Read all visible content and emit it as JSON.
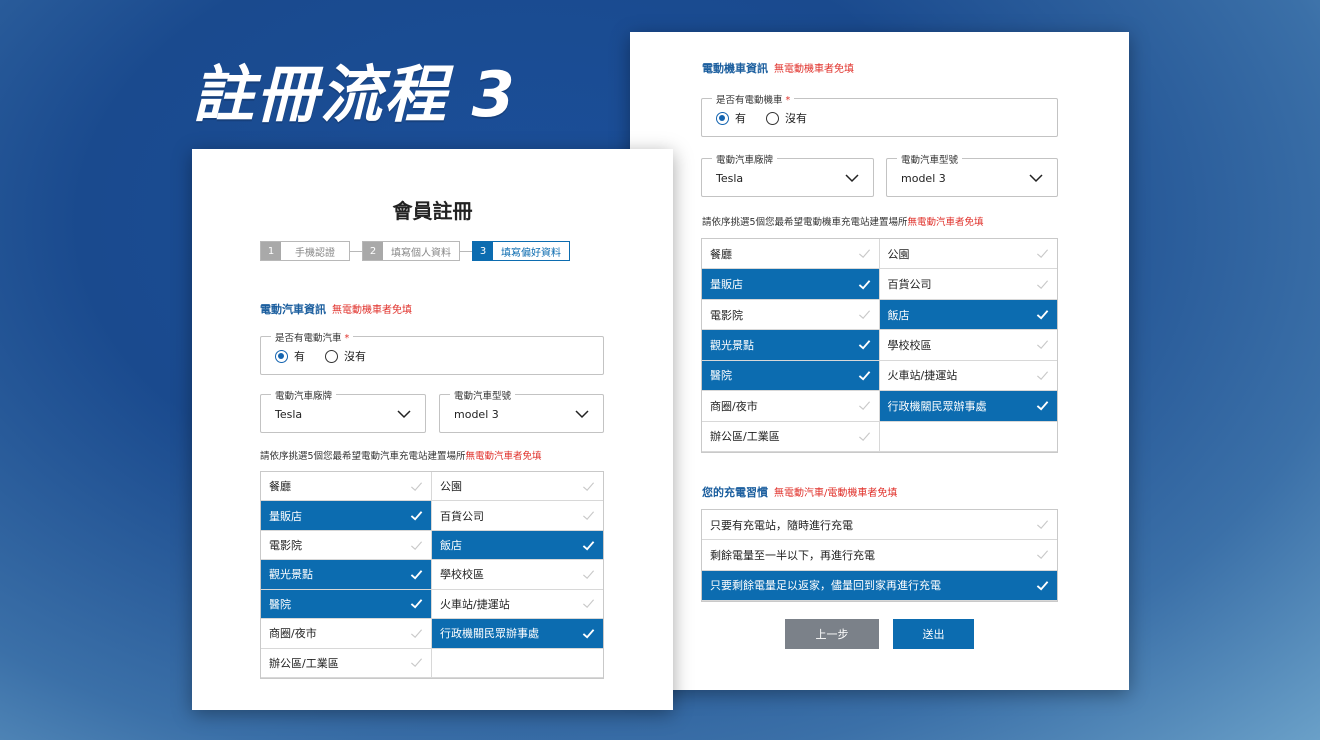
{
  "hero_title": "註冊流程 3",
  "back": {
    "moto_section": {
      "title": "電動機車資訊",
      "note": "無電動機車者免填"
    },
    "has_moto": {
      "legend": "是否有電動機車",
      "req": "*",
      "yes": "有",
      "no": "沒有"
    },
    "brand": {
      "legend": "電動汽車廠牌",
      "value": "Tesla"
    },
    "model": {
      "legend": "電動汽車型號",
      "value": "model 3"
    },
    "hint": {
      "text": "請依序挑選5個您最希望電動機車充電站建置場所",
      "note": "無電動汽車者免填"
    },
    "places": [
      {
        "label": "餐廳",
        "selected": false
      },
      {
        "label": "公園",
        "selected": false
      },
      {
        "label": "量販店",
        "selected": true
      },
      {
        "label": "百貨公司",
        "selected": false
      },
      {
        "label": "電影院",
        "selected": false
      },
      {
        "label": "飯店",
        "selected": true
      },
      {
        "label": "觀光景點",
        "selected": true
      },
      {
        "label": "學校校區",
        "selected": false
      },
      {
        "label": "醫院",
        "selected": true
      },
      {
        "label": "火車站/捷運站",
        "selected": false
      },
      {
        "label": "商圈/夜市",
        "selected": false
      },
      {
        "label": "行政機關民眾辦事處",
        "selected": true
      },
      {
        "label": "辦公區/工業區",
        "selected": false
      }
    ],
    "habit_section": {
      "title": "您的充電習慣",
      "note": "無電動汽車/電動機車者免填"
    },
    "habits": [
      {
        "label": "只要有充電站，隨時進行充電",
        "selected": false
      },
      {
        "label": "剩餘電量至一半以下，再進行充電",
        "selected": false
      },
      {
        "label": "只要剩餘電量足以返家，儘量回到家再進行充電",
        "selected": true
      }
    ],
    "prev_label": "上一步",
    "submit_label": "送出"
  },
  "front": {
    "heading": "會員註冊",
    "steps": [
      {
        "num": "1",
        "label": "手機認證"
      },
      {
        "num": "2",
        "label": "填寫個人資料"
      },
      {
        "num": "3",
        "label": "填寫偏好資料"
      }
    ],
    "car_section": {
      "title": "電動汽車資訊",
      "note": "無電動機車者免填"
    },
    "has_car": {
      "legend": "是否有電動汽車",
      "req": "*",
      "yes": "有",
      "no": "沒有"
    },
    "brand": {
      "legend": "電動汽車廠牌",
      "value": "Tesla"
    },
    "model": {
      "legend": "電動汽車型號",
      "value": "model 3"
    },
    "hint": {
      "text": "請依序挑選5個您最希望電動汽車充電站建置場所",
      "note": "無電動汽車者免填"
    },
    "places": [
      {
        "label": "餐廳",
        "selected": false
      },
      {
        "label": "公園",
        "selected": false
      },
      {
        "label": "量販店",
        "selected": true
      },
      {
        "label": "百貨公司",
        "selected": false
      },
      {
        "label": "電影院",
        "selected": false
      },
      {
        "label": "飯店",
        "selected": true
      },
      {
        "label": "觀光景點",
        "selected": true
      },
      {
        "label": "學校校區",
        "selected": false
      },
      {
        "label": "醫院",
        "selected": true
      },
      {
        "label": "火車站/捷運站",
        "selected": false
      },
      {
        "label": "商圈/夜市",
        "selected": false
      },
      {
        "label": "行政機關民眾辦事處",
        "selected": true
      },
      {
        "label": "辦公區/工業區",
        "selected": false
      }
    ]
  },
  "colors": {
    "accent": "#0c6cb0",
    "note": "#e0302a",
    "prev": "#7b8189"
  }
}
